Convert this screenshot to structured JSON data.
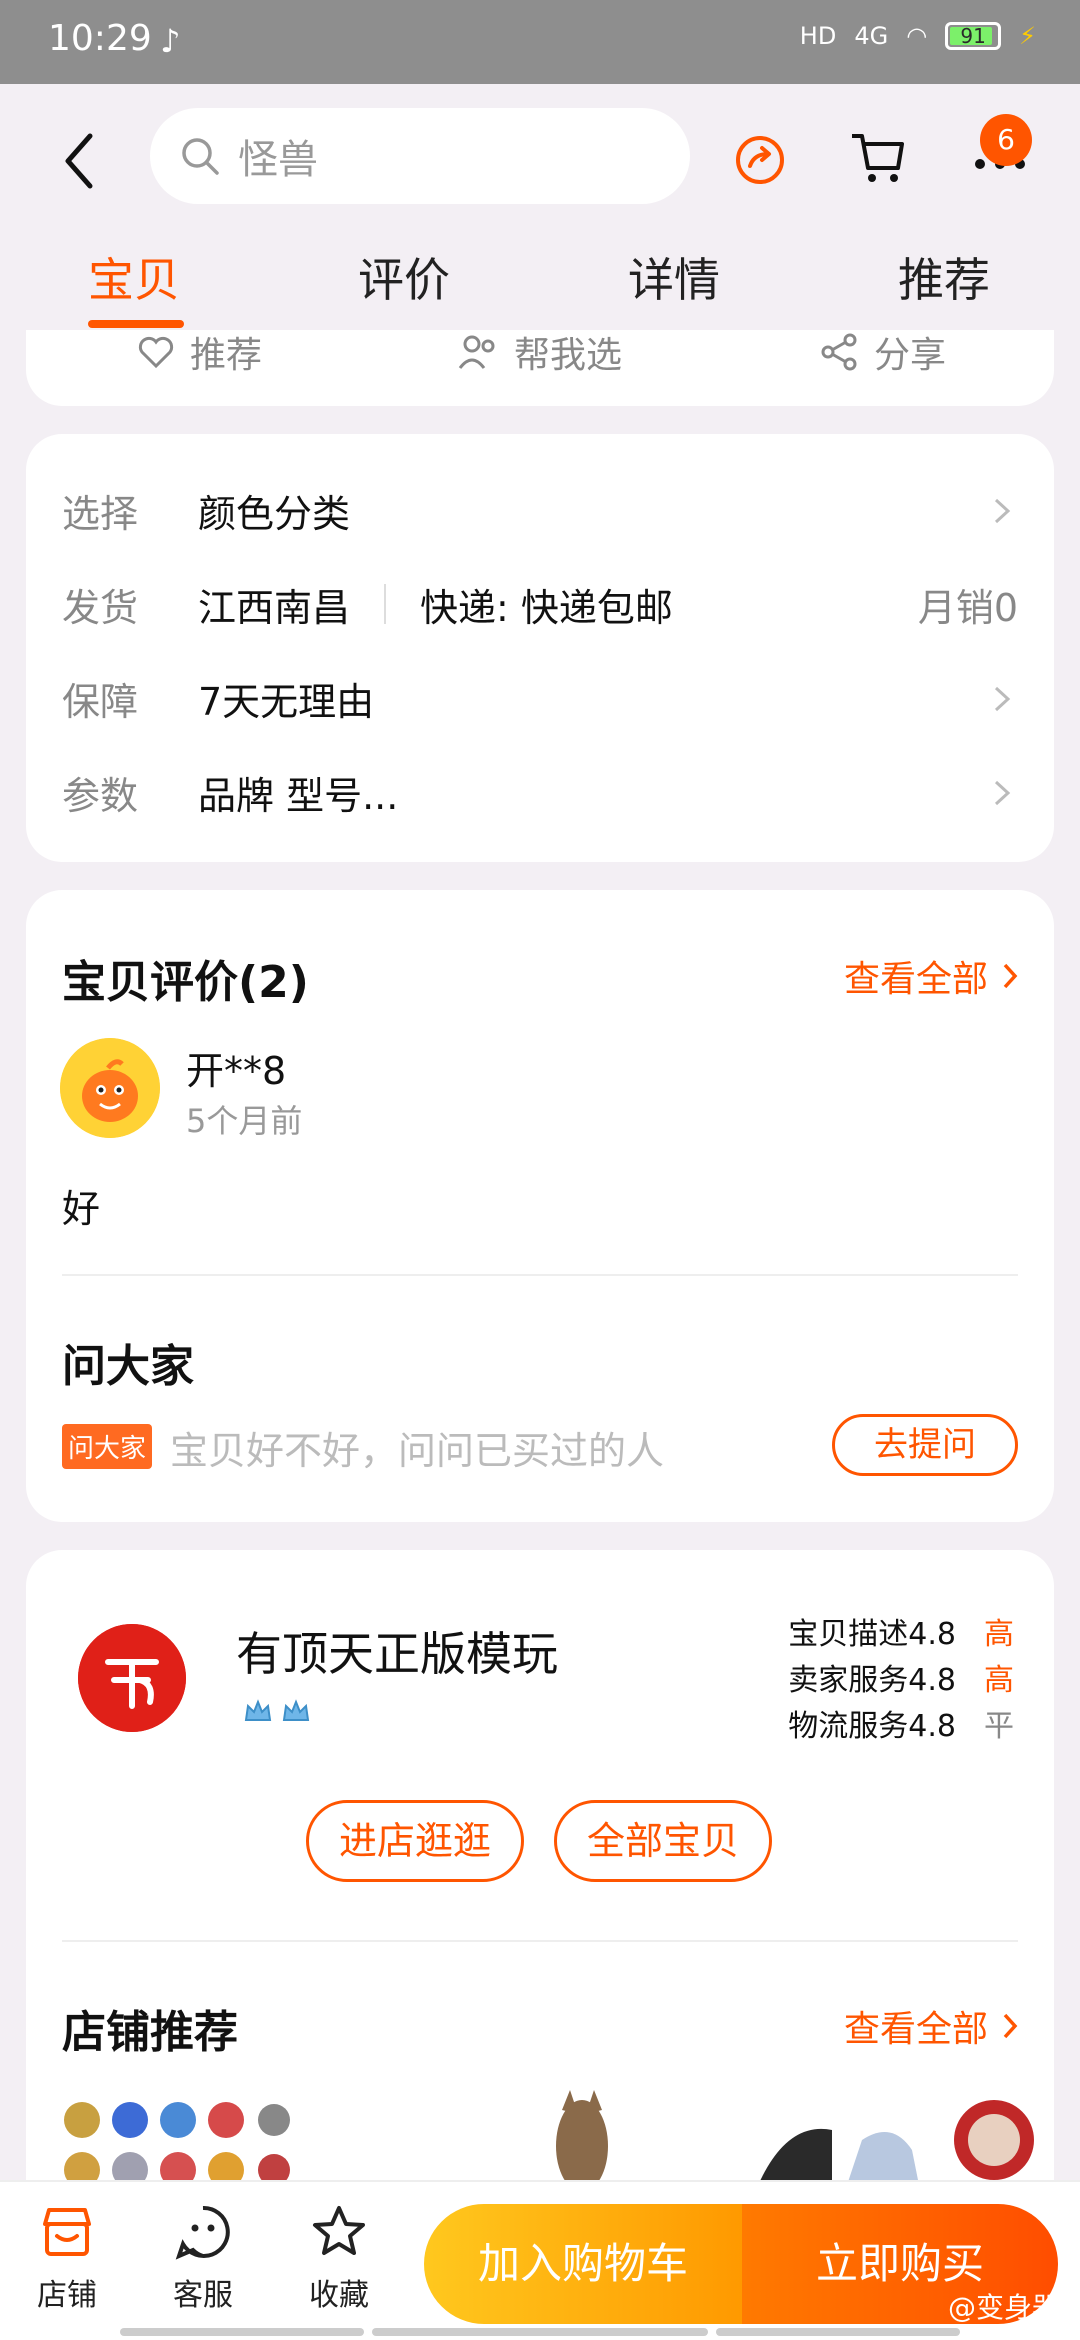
{
  "status_bar": {
    "time": "10:29",
    "battery": "91",
    "network": "4G"
  },
  "header": {
    "search_placeholder": "怪兽",
    "cart_badge": "6",
    "tabs": [
      {
        "label": "宝贝"
      },
      {
        "label": "评价"
      },
      {
        "label": "详情"
      },
      {
        "label": "推荐"
      }
    ]
  },
  "actions": {
    "recommend": "推荐",
    "help_choose": "帮我选",
    "share": "分享"
  },
  "info": {
    "select_label": "选择",
    "select_value": "颜色分类",
    "ship_label": "发货",
    "ship_from": "江西南昌",
    "ship_method": "快递: 快递包邮",
    "monthly_sales": "月销0",
    "guarantee_label": "保障",
    "guarantee_value": "7天无理由",
    "params_label": "参数",
    "params_value": "品牌 型号..."
  },
  "reviews": {
    "title": "宝贝评价(2)",
    "see_all": "查看全部",
    "reviewer": "开**8",
    "time": "5个月前",
    "content": "好"
  },
  "ask": {
    "title": "问大家",
    "tag": "问大家",
    "placeholder": "宝贝好不好，问问已买过的人",
    "button": "去提问"
  },
  "shop": {
    "name": "有顶天正版模玩",
    "scores": [
      {
        "label": "宝贝描述4.8",
        "level": "高"
      },
      {
        "label": "卖家服务4.8",
        "level": "高"
      },
      {
        "label": "物流服务4.8",
        "level": "平"
      }
    ],
    "enter_button": "进店逛逛",
    "all_items_button": "全部宝贝",
    "recommend_title": "店铺推荐",
    "recommend_see_all": "查看全部"
  },
  "bottom_bar": {
    "shop": "店铺",
    "service": "客服",
    "favorite": "收藏",
    "add_cart": "加入购物车",
    "buy_now": "立即购买"
  },
  "watermark": "@变身器",
  "colors": {
    "accent": "#ff5500",
    "cart_button": "#ffb114",
    "buy_button": "#ff5e00"
  }
}
